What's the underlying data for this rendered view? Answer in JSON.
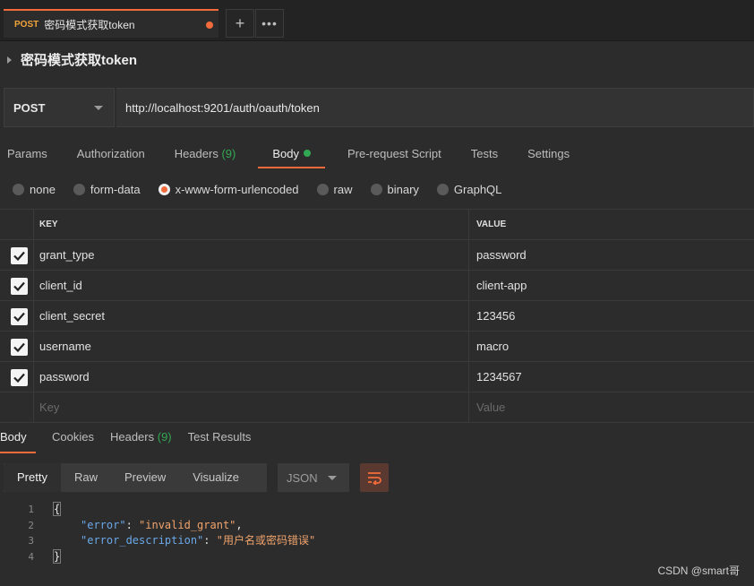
{
  "request_tab": {
    "method": "POST",
    "name": "密码模式获取token"
  },
  "tab_actions": {
    "plus": "+",
    "more": "•••"
  },
  "title": "密码模式获取token",
  "url_bar": {
    "method": "POST",
    "url": "http://localhost:9201/auth/oauth/token"
  },
  "request_tabs": [
    {
      "label": "Params"
    },
    {
      "label": "Authorization"
    },
    {
      "label": "Headers",
      "count": "(9)"
    },
    {
      "label": "Body"
    },
    {
      "label": "Pre-request Script"
    },
    {
      "label": "Tests"
    },
    {
      "label": "Settings"
    }
  ],
  "body_types": [
    "none",
    "form-data",
    "x-www-form-urlencoded",
    "raw",
    "binary",
    "GraphQL"
  ],
  "body_type_selected": "x-www-form-urlencoded",
  "kv_table": {
    "key_header": "KEY",
    "value_header": "VALUE",
    "rows": [
      {
        "key": "grant_type",
        "value": "password"
      },
      {
        "key": "client_id",
        "value": "client-app"
      },
      {
        "key": "client_secret",
        "value": "123456"
      },
      {
        "key": "username",
        "value": "macro"
      },
      {
        "key": "password",
        "value": "1234567"
      }
    ],
    "key_placeholder": "Key",
    "value_placeholder": "Value"
  },
  "response_tabs": [
    {
      "label": "Body"
    },
    {
      "label": "Cookies"
    },
    {
      "label": "Headers",
      "count": "(9)"
    },
    {
      "label": "Test Results"
    }
  ],
  "format_options": [
    "Pretty",
    "Raw",
    "Preview",
    "Visualize"
  ],
  "language": "JSON",
  "code": {
    "line_numbers": [
      "1",
      "2",
      "3",
      "4"
    ],
    "open_brace": "{",
    "close_brace": "}",
    "lines": [
      {
        "key": "\"error\"",
        "value": "\"invalid_grant\"",
        "trail": ","
      },
      {
        "key": "\"error_description\"",
        "value": "\"用户名或密码错误\"",
        "trail": ""
      }
    ]
  },
  "watermark": "CSDN @smart哥",
  "colors": {
    "accent": "#f26b3a",
    "success": "#32a852",
    "json_key": "#6aa8e8",
    "json_string": "#f0a36c"
  }
}
